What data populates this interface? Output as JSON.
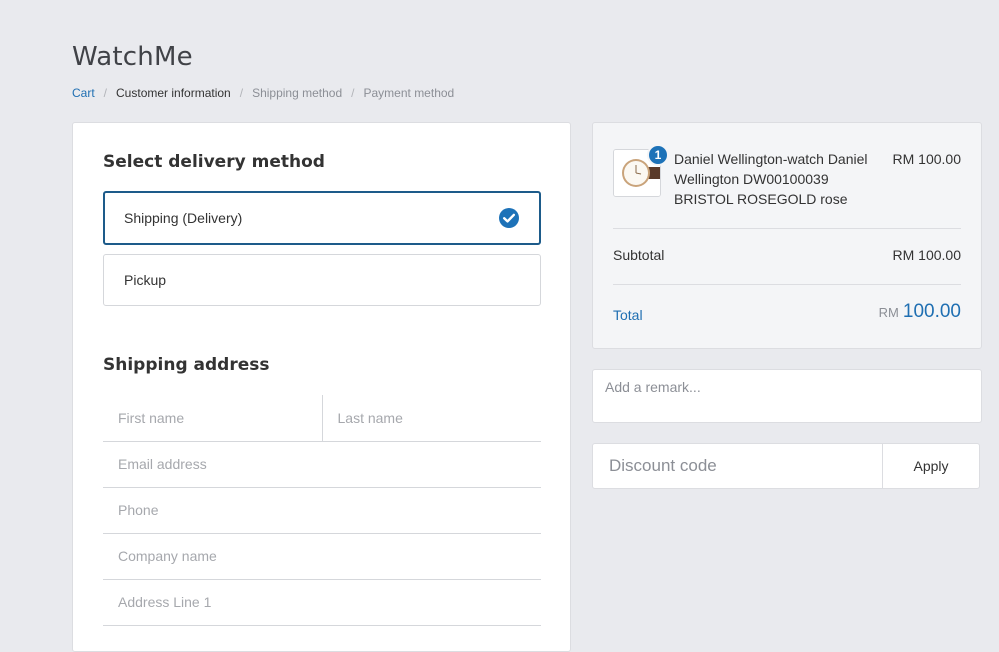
{
  "store": {
    "title": "WatchMe"
  },
  "breadcrumb": [
    {
      "label": "Cart"
    },
    {
      "label": "Customer information"
    },
    {
      "label": "Shipping method"
    },
    {
      "label": "Payment method"
    }
  ],
  "breadcrumb_separator": "/",
  "delivery": {
    "heading": "Select delivery method",
    "options": [
      {
        "label": "Shipping (Delivery)",
        "selected": true
      },
      {
        "label": "Pickup",
        "selected": false
      }
    ]
  },
  "shipping_address": {
    "heading": "Shipping address",
    "fields": {
      "first_name": "First name",
      "last_name": "Last name",
      "email": "Email address",
      "phone": "Phone",
      "company": "Company name",
      "address_line_1": "Address Line 1"
    }
  },
  "order_summary": {
    "product": {
      "name": "Daniel Wellington-watch Daniel Wellington DW00100039 BRISTOL ROSEGOLD rose",
      "price": "RM 100.00",
      "quantity": "1"
    },
    "subtotal_label": "Subtotal",
    "subtotal_value": "RM 100.00",
    "total_label": "Total",
    "total_currency": "RM",
    "total_amount": "100.00"
  },
  "remark": {
    "placeholder": "Add a remark..."
  },
  "discount": {
    "placeholder": "Discount code",
    "apply_label": "Apply"
  },
  "colors": {
    "accent": "#1f6fb2",
    "selected_border": "#1d5b8a",
    "background": "#e9eaee"
  },
  "icons": {
    "selected_option": "check-circle-icon"
  }
}
